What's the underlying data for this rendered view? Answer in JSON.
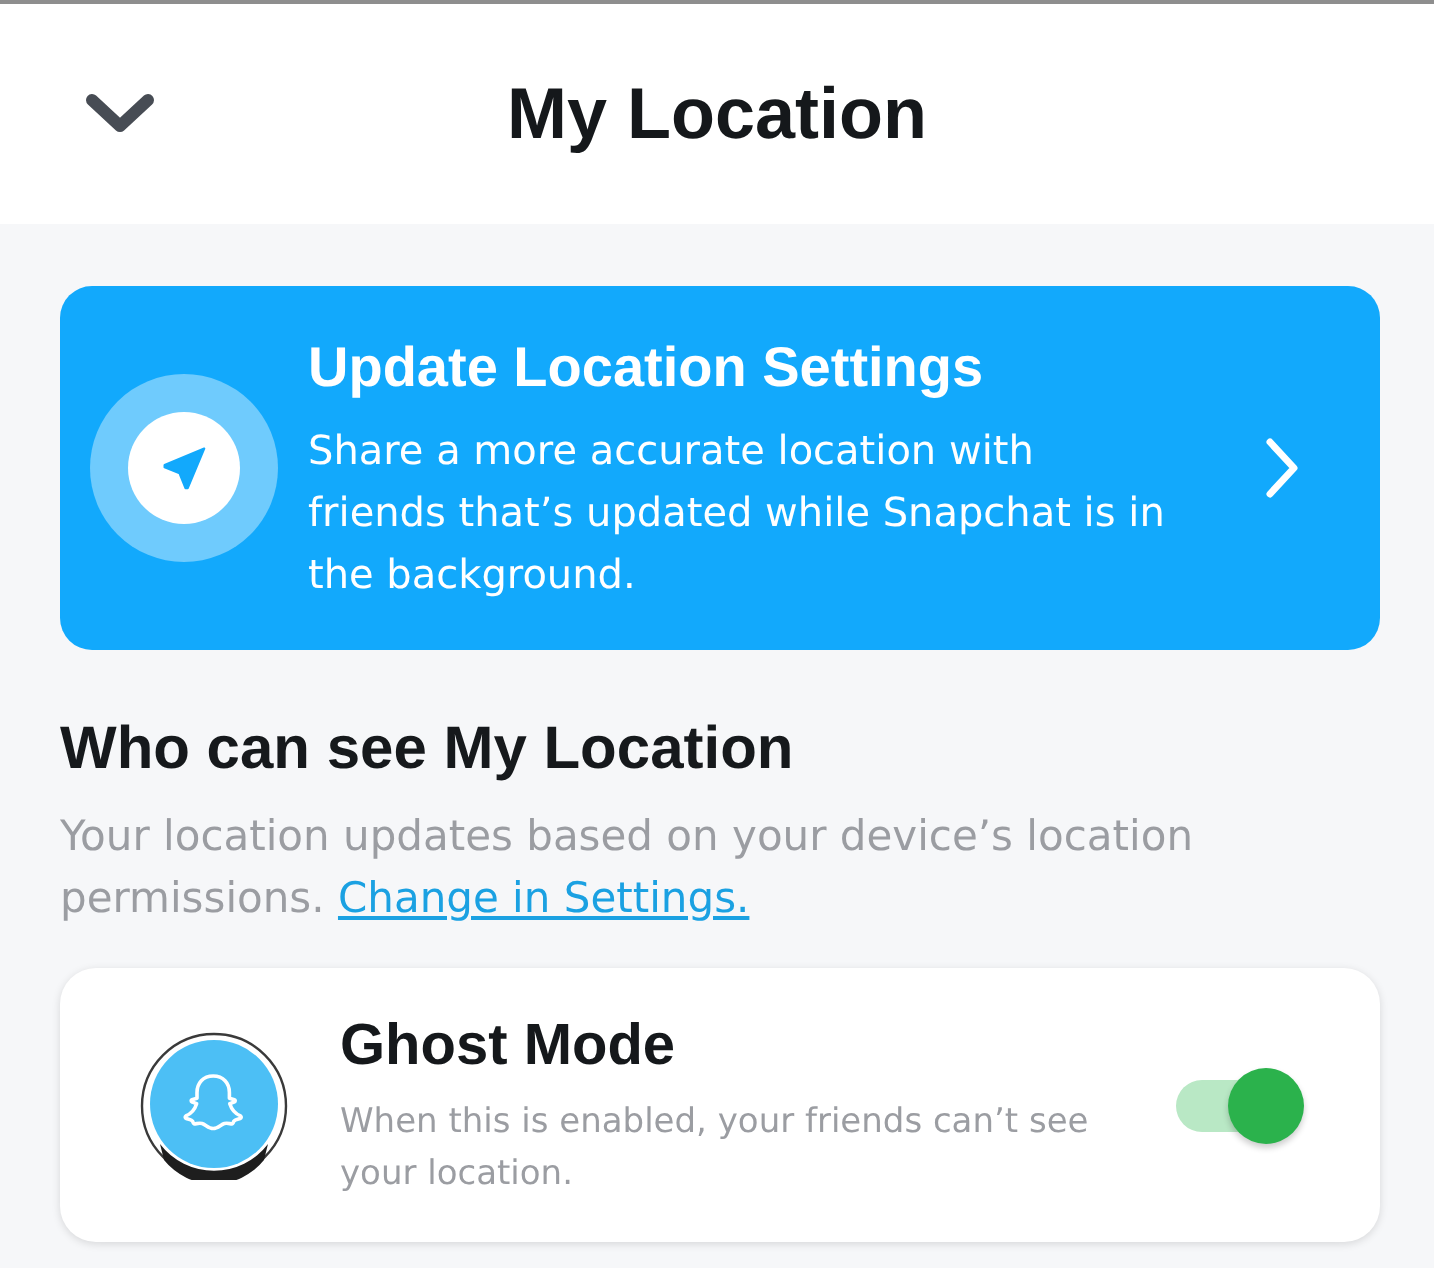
{
  "header": {
    "title": "My Location"
  },
  "banner": {
    "title": "Update Location Settings",
    "text": "Share a more accurate location with friends that’s updated while Snapchat is in the background."
  },
  "section": {
    "heading": "Who can see My Location",
    "text": "Your location updates based on your device’s location permissions.",
    "link": "Change in Settings."
  },
  "ghost_mode": {
    "title": "Ghost Mode",
    "text": "When this is enabled, your friends can’t see your location.",
    "on": true
  }
}
